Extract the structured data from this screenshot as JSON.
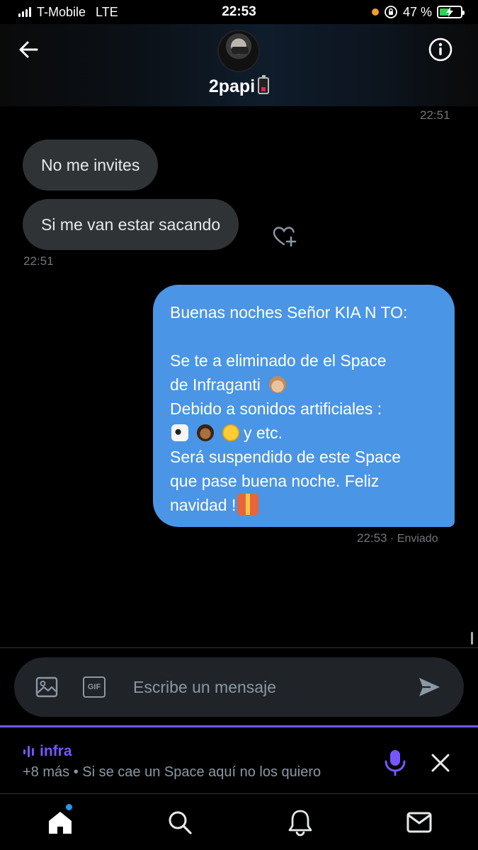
{
  "status_bar": {
    "carrier": "T-Mobile",
    "network": "LTE",
    "time": "22:53",
    "battery_percent": "47 %",
    "battery_level": 0.47,
    "icons": [
      "signal-icon",
      "orange-dot-icon",
      "rotation-lock-icon",
      "battery-charging-icon"
    ]
  },
  "header": {
    "contact_name": "2papi",
    "icons": [
      "back-arrow-icon",
      "avatar",
      "info-icon"
    ]
  },
  "conversation": {
    "top_timestamp": "22:51",
    "incoming": [
      {
        "text": "No me invites"
      },
      {
        "text": "Si me van estar sacando"
      }
    ],
    "incoming_timestamp": "22:51",
    "outgoing": {
      "line1": "Buenas noches Señor KIA N TO:",
      "line2": "Se te a eliminado de el Space",
      "line3": "de Infraganti",
      "line4": "Debido a sonidos artificiales :",
      "line5": "y etc.",
      "line6": "Será suspendido de este Space",
      "line7": "que pase buena noche. Feliz",
      "line8": "navidad !"
    },
    "outgoing_timestamp": "22:53",
    "outgoing_status": " · Enviado"
  },
  "composer": {
    "placeholder": "Escribe un mensaje",
    "gif_label": "GIF"
  },
  "space_dock": {
    "space_name": "infra",
    "info": "+8 más • Si se cae un Space aquí no los quiero"
  },
  "tab_bar": {
    "tabs": [
      "home-icon",
      "search-icon",
      "notifications-icon",
      "messages-icon"
    ]
  },
  "colors": {
    "background": "#000000",
    "incoming_bubble": "#2f3336",
    "outgoing_bubble": "#4a95e5",
    "space_accent": "#7856ff",
    "notification_dot": "#1d9bf0",
    "battery_charging": "#30d158"
  }
}
